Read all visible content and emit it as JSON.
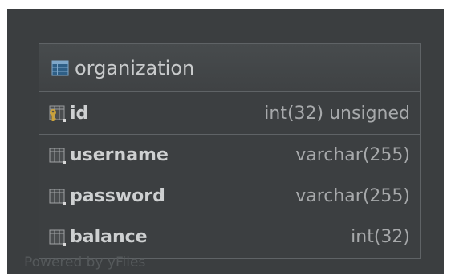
{
  "entity": {
    "title": "organization",
    "primary_key": {
      "name": "id",
      "type": "int(32) unsigned"
    },
    "fields": [
      {
        "name": "username",
        "type": "varchar(255)"
      },
      {
        "name": "password",
        "type": "varchar(255)"
      },
      {
        "name": "balance",
        "type": "int(32)"
      }
    ]
  },
  "watermark": "Powered by yFiles",
  "colors": {
    "canvas": "#3b3e40",
    "border": "#5f6366",
    "table_icon": "#7fa7c9",
    "key_icon": "#c9a13a"
  }
}
